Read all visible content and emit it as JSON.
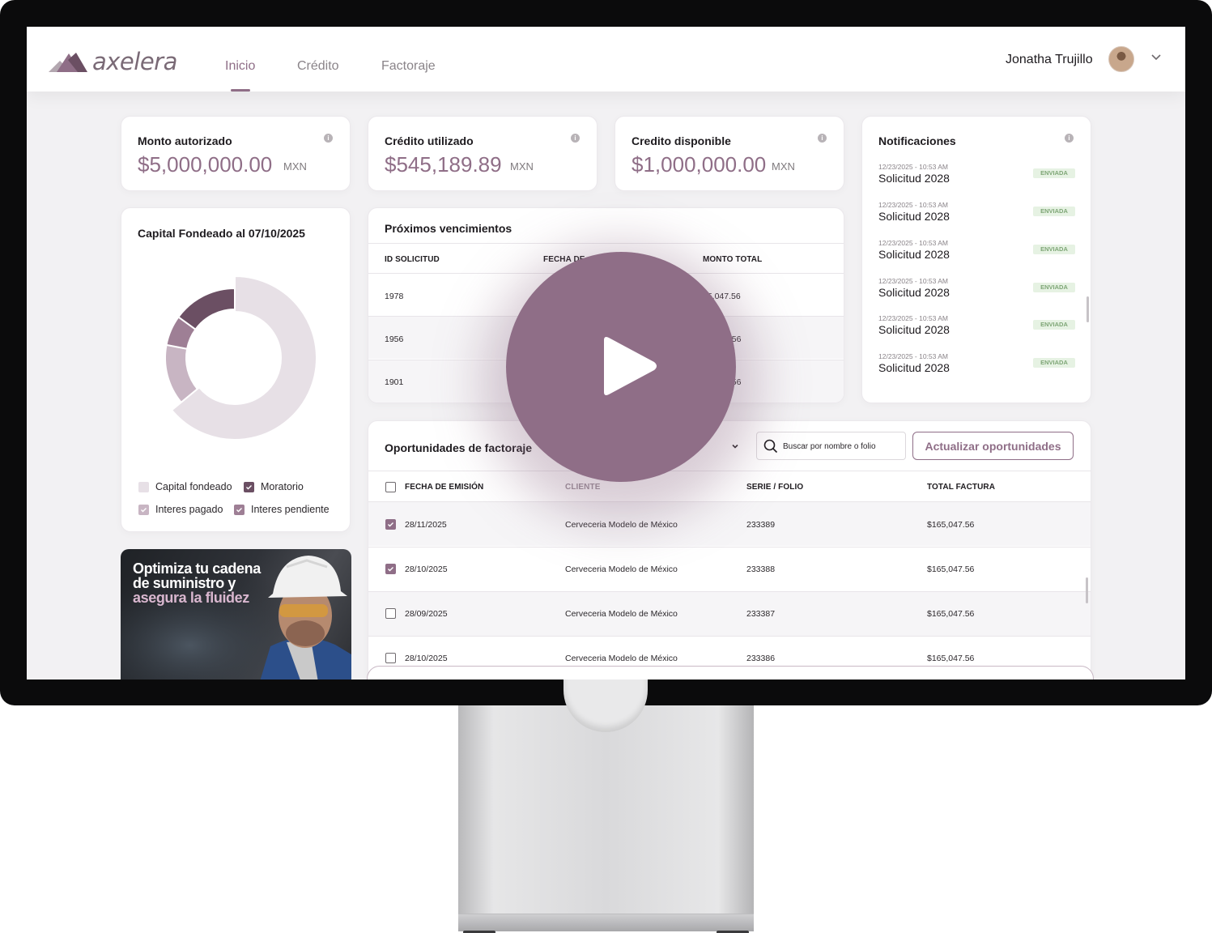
{
  "app": {
    "brand": "axelera"
  },
  "nav": {
    "tabs": [
      {
        "label": "Inicio",
        "active": true
      },
      {
        "label": "Crédito",
        "active": false
      },
      {
        "label": "Factoraje",
        "active": false
      }
    ]
  },
  "user": {
    "name": "Jonatha Trujillo"
  },
  "summary": {
    "authorized": {
      "title": "Monto autorizado",
      "amount": "$5,000,000.00",
      "currency": "MXN"
    },
    "used": {
      "title": "Crédito utilizado",
      "amount": "$545,189.89",
      "currency": "MXN"
    },
    "available": {
      "title": "Credito disponible",
      "amount": "$1,000,000.00",
      "currency": "MXN"
    }
  },
  "capital": {
    "title": "Capital Fondeado al 07/10/2025",
    "legend": [
      {
        "label": "Capital fondeado",
        "color": "#e7e0e6",
        "checked": false
      },
      {
        "label": "Moratorio",
        "color": "#6b4f63",
        "checked": true
      },
      {
        "label": "Interes pagado",
        "color": "#c8b5c3",
        "checked": true
      },
      {
        "label": "Interes pendiente",
        "color": "#9e7f95",
        "checked": true
      }
    ]
  },
  "chart_data": {
    "type": "pie",
    "categories": [
      "Capital fondeado",
      "Moratorio",
      "Interes pagado",
      "Interes pendiente"
    ],
    "values": [
      64,
      15,
      14,
      7
    ],
    "colors": [
      "#e7e0e6",
      "#6b4f63",
      "#c8b5c3",
      "#9e7f95"
    ],
    "title": "Capital Fondeado al 07/10/2025",
    "donut": true,
    "legend": "bottom"
  },
  "upcoming": {
    "title": "Próximos vencimientos",
    "columns": [
      "ID SOLICITUD",
      "FECHA DE",
      "MONTO TOTAL"
    ],
    "rows": [
      {
        "id": "1978",
        "amount": "65,047.56"
      },
      {
        "id": "1956",
        "amount": "7.56"
      },
      {
        "id": "1901",
        "amount": "7.56"
      }
    ]
  },
  "notifications": {
    "title": "Notificaciones",
    "items": [
      {
        "time": "12/23/2025 - 10:53 AM",
        "title": "Solicitud 2028",
        "status": "ENVIADA"
      },
      {
        "time": "12/23/2025 - 10:53 AM",
        "title": "Solicitud 2028",
        "status": "ENVIADA"
      },
      {
        "time": "12/23/2025 - 10:53 AM",
        "title": "Solicitud 2028",
        "status": "ENVIADA"
      },
      {
        "time": "12/23/2025 - 10:53 AM",
        "title": "Solicitud 2028",
        "status": "ENVIADA"
      },
      {
        "time": "12/23/2025 - 10:53 AM",
        "title": "Solicitud 2028",
        "status": "ENVIADA"
      },
      {
        "time": "12/23/2025 - 10:53 AM",
        "title": "Solicitud 2028",
        "status": "ENVIADA"
      }
    ]
  },
  "opportunities": {
    "title": "Oportunidades de factoraje",
    "search_placeholder": "Buscar por nombre o folio",
    "refresh_label": "Actualizar oportunidades",
    "columns": [
      "FECHA DE EMISIÓN",
      "CLIENTE",
      "SERIE / FOLIO",
      "TOTAL FACTURA"
    ],
    "rows": [
      {
        "checked": true,
        "date": "28/11/2025",
        "client": "Cerveceria Modelo de México",
        "folio": "233389",
        "total": "$165,047.56"
      },
      {
        "checked": true,
        "date": "28/10/2025",
        "client": "Cerveceria Modelo de México",
        "folio": "233388",
        "total": "$165,047.56"
      },
      {
        "checked": false,
        "date": "28/09/2025",
        "client": "Cerveceria Modelo de México",
        "folio": "233387",
        "total": "$165,047.56"
      },
      {
        "checked": false,
        "date": "28/10/2025",
        "client": "Cerveceria Modelo de México",
        "folio": "233386",
        "total": "$165,047.56"
      }
    ]
  },
  "promo": {
    "line1": "Optimiza tu cadena",
    "line2": "de suministro y",
    "line3": "asegura la fluidez"
  }
}
